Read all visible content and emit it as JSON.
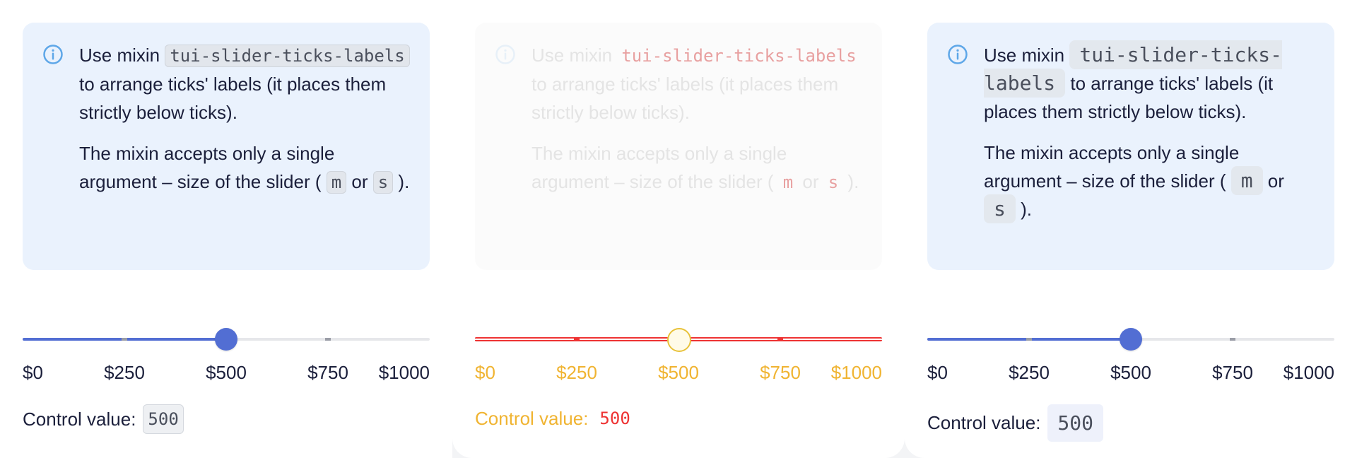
{
  "examples": [
    {
      "notice": {
        "p1_before": "Use mixin ",
        "mixin_name": "tui-slider-ticks-labels",
        "p1_after": " to arrange ticks' labels (it places them strictly below ticks).",
        "p2_before": "The mixin accepts only a single argument – size of the slider ( ",
        "size_m": "m",
        "or": " or ",
        "size_s": "s",
        "p2_after": " )."
      },
      "slider": {
        "value": 500,
        "min": 0,
        "max": 1000,
        "tick_labels": [
          "$0",
          "$250",
          "$500",
          "$750",
          "$1000"
        ]
      },
      "control": {
        "label": "Control value:",
        "value": "500"
      }
    },
    {
      "notice": {
        "p1_before": "Use mixin ",
        "mixin_name": "tui-slider-ticks-labels",
        "p1_after": " to arrange ticks' labels (it places them strictly below ticks).",
        "p2_before": "The mixin accepts only a single argument – size of the slider ( ",
        "size_m": "m",
        "or": " or ",
        "size_s": "s",
        "p2_after": " )."
      },
      "slider": {
        "value": 500,
        "min": 0,
        "max": 1000,
        "tick_labels": [
          "$0",
          "$250",
          "$500",
          "$750",
          "$1000"
        ]
      },
      "control": {
        "label": "Control value:",
        "value": "500"
      }
    },
    {
      "notice": {
        "p1_before": "Use mixin ",
        "mixin_name": "tui-slider-ticks-labels",
        "p1_after": " to arrange ticks' labels (it places them strictly below ticks).",
        "p2_before": "The mixin accepts only a single argument – size of the slider ( ",
        "size_m": "m",
        "or": " or ",
        "size_s": "s",
        "p2_after": " )."
      },
      "slider": {
        "value": 500,
        "min": 0,
        "max": 1000,
        "tick_labels": [
          "$0",
          "$250",
          "$500",
          "$750",
          "$1000"
        ]
      },
      "control": {
        "label": "Control value:",
        "value": "500"
      }
    }
  ],
  "colors": {
    "accent": "#526ed3",
    "notice_bg": "#eaf2fd",
    "info_icon": "#5ea7e8",
    "text": "#1b1f3b"
  },
  "icons": {
    "notice": "info-circle-icon"
  }
}
